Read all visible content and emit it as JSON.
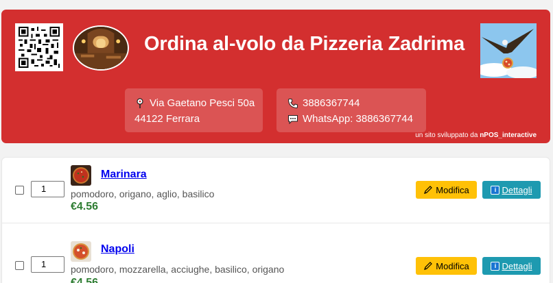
{
  "header": {
    "title": "Ordina al-volo da Pizzeria Zadrima",
    "address_line1": "Via Gaetano Pesci 50a",
    "address_line2": "44122 Ferrara",
    "phone": "3886367744",
    "whatsapp": "WhatsApp: 3886367744",
    "credit_prefix": "un sito sviluppato da ",
    "credit_brand": "nPOS_interactive",
    "bg_color": "#d32f2f"
  },
  "icons": {
    "qr": "qr-code-icon",
    "logo": "restaurant-logo",
    "eagle": "eagle-pizza-image",
    "pin": "map-pin-icon",
    "phone": "phone-icon",
    "chat": "chat-icon",
    "pencil": "pencil-icon",
    "info": "info-icon"
  },
  "menu": {
    "items": [
      {
        "name": "Marinara",
        "ingredients": "pomodoro, origano, aglio, basilico",
        "price": "€4.56",
        "quantity": "1",
        "edit_label": "Modifica",
        "details_label": "Dettagli"
      },
      {
        "name": "Napoli",
        "ingredients": "pomodoro, mozzarella, acciughe, basilico, origano",
        "price": "€4.56",
        "quantity": "1",
        "edit_label": "Modifica",
        "details_label": "Dettagli"
      }
    ]
  }
}
